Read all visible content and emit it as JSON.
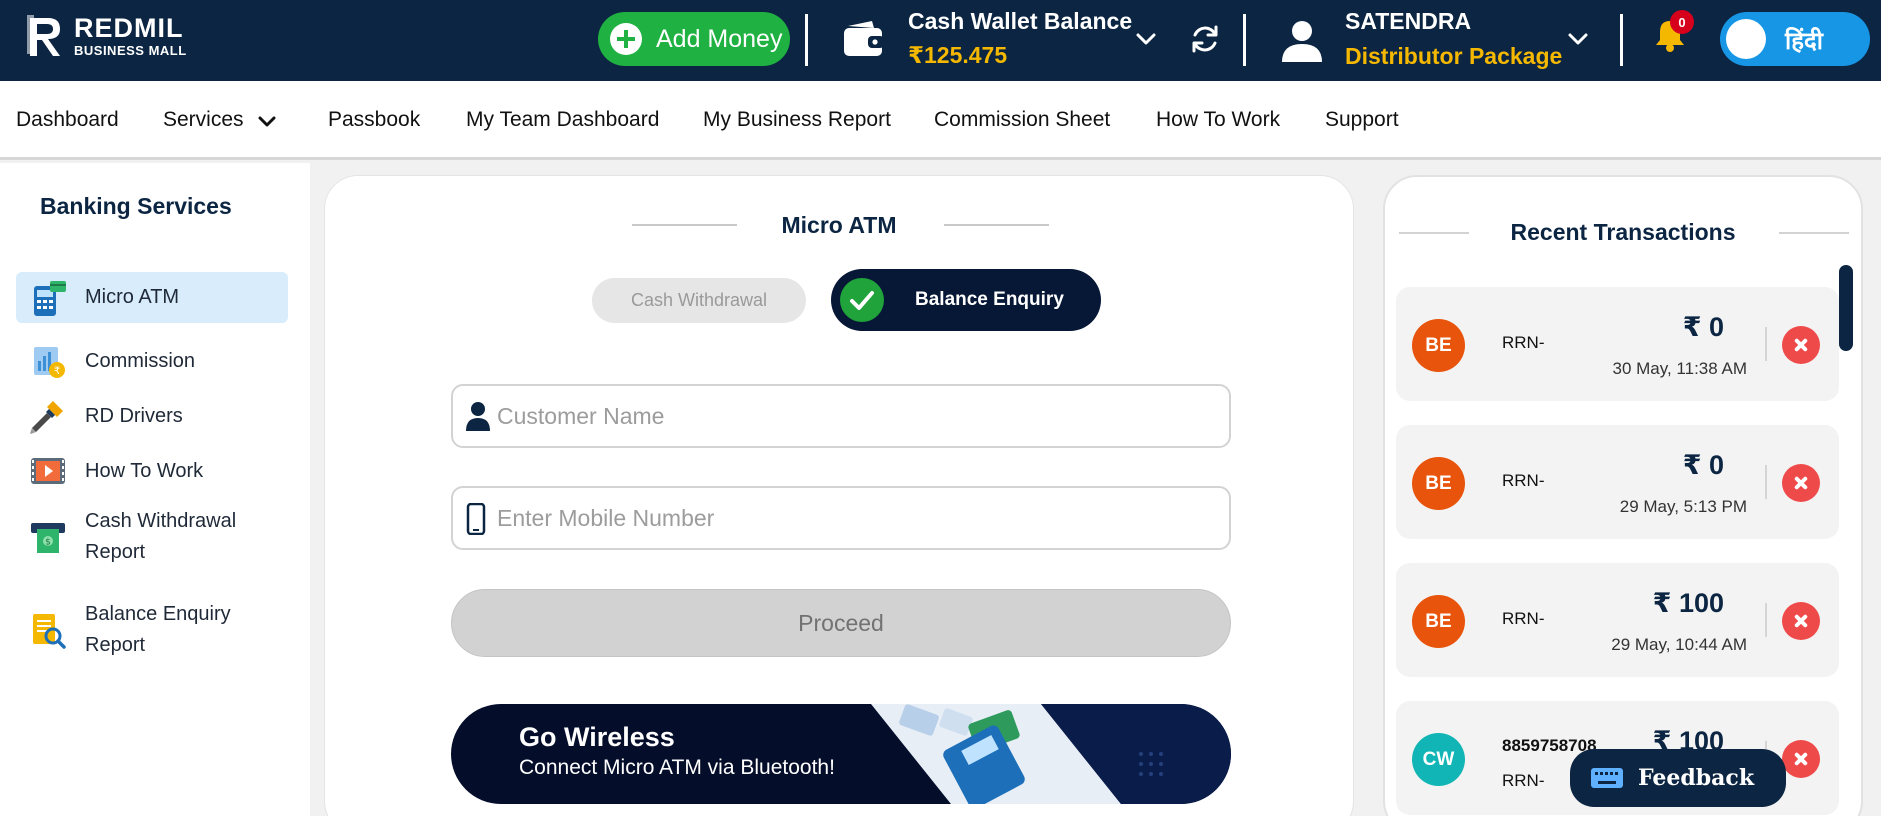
{
  "header": {
    "logo_title": "REDMIL",
    "logo_sub": "BUSINESS MALL",
    "add_money_label": "Add Money",
    "wallet_title": "Cash Wallet Balance",
    "wallet_amount": "₹125.475",
    "user_name": "SATENDRA",
    "user_package": "Distributor Package",
    "notification_count": "0",
    "language_label": "हिंदी"
  },
  "nav": {
    "items": [
      "Dashboard",
      "Services",
      "Passbook",
      "My Team Dashboard",
      "My Business Report",
      "Commission Sheet",
      "How To Work",
      "Support"
    ]
  },
  "sidebar": {
    "title": "Banking Services",
    "items": [
      {
        "label": "Micro ATM",
        "icon": "micro-atm-icon"
      },
      {
        "label": "Commission",
        "icon": "commission-icon"
      },
      {
        "label": "RD Drivers",
        "icon": "screwdriver-icon"
      },
      {
        "label": "How To Work",
        "icon": "video-icon"
      },
      {
        "label": "Cash Withdrawal Report",
        "icon": "cash-machine-icon"
      },
      {
        "label": "Balance Enquiry Report",
        "icon": "report-search-icon"
      }
    ]
  },
  "main": {
    "title": "Micro ATM",
    "tab_inactive": "Cash Withdrawal",
    "tab_active": "Balance Enquiry",
    "customer_name_placeholder": "Customer Name",
    "mobile_placeholder": "Enter Mobile Number",
    "proceed_label": "Proceed",
    "banner_title": "Go Wireless",
    "banner_sub": "Connect Micro ATM via Bluetooth!"
  },
  "transactions": {
    "title": "Recent Transactions",
    "items": [
      {
        "type": "BE",
        "rrn": "RRN-",
        "amount": "₹ 0",
        "date": "30 May, 11:38 AM"
      },
      {
        "type": "BE",
        "rrn": "RRN-",
        "amount": "₹ 0",
        "date": "29 May, 5:13 PM"
      },
      {
        "type": "BE",
        "rrn": "RRN-",
        "amount": "₹ 100",
        "date": "29 May, 10:44 AM"
      },
      {
        "type": "CW",
        "number": "8859758708",
        "rrn": "RRN-",
        "amount": "₹ 100"
      }
    ]
  },
  "feedback_label": "Feedback",
  "colors": {
    "header_bg": "#0b2542",
    "accent_yellow": "#f5b800",
    "add_money_green": "#1fb141",
    "language_blue": "#1796e6",
    "be_avatar": "#e8540b",
    "cw_avatar": "#12b5b5",
    "close_red": "#ef4a4a",
    "active_tab_bg": "#061836"
  }
}
